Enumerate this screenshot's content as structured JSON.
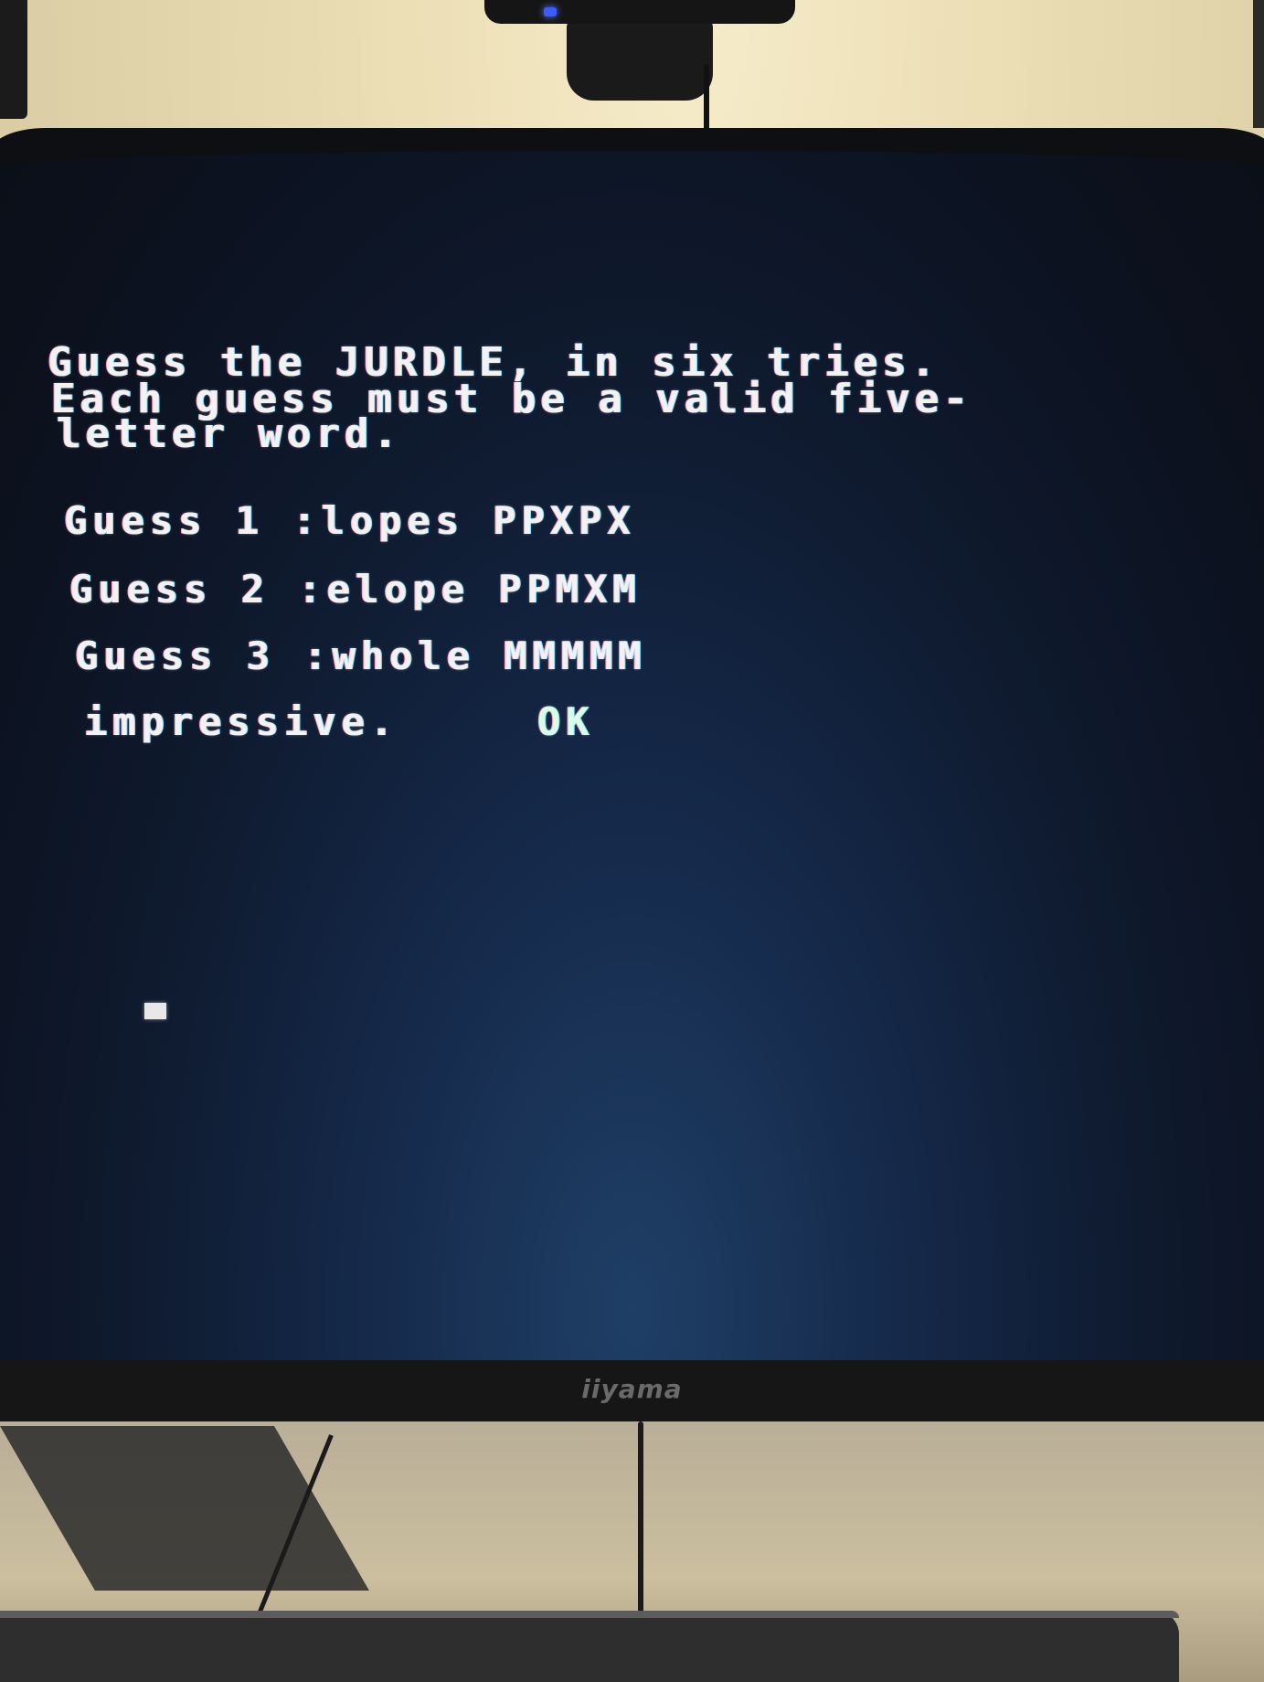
{
  "game": {
    "intro_lines": [
      "Guess the JURDLE, in six tries.",
      "Each guess must be a valid five-",
      "letter word."
    ],
    "guesses": [
      {
        "label": "Guess 1 :lopes PPXPX"
      },
      {
        "label": "Guess 2 :elope PPMXM"
      },
      {
        "label": "Guess 3 :whole MMMMM"
      }
    ],
    "result": {
      "message": "impressive.",
      "ok": "OK"
    }
  },
  "monitor": {
    "brand": "iiyama"
  },
  "colors": {
    "screen_text": "#f2f2f2",
    "screen_background": "#0f1b30",
    "bezel": "#0e0f12"
  }
}
